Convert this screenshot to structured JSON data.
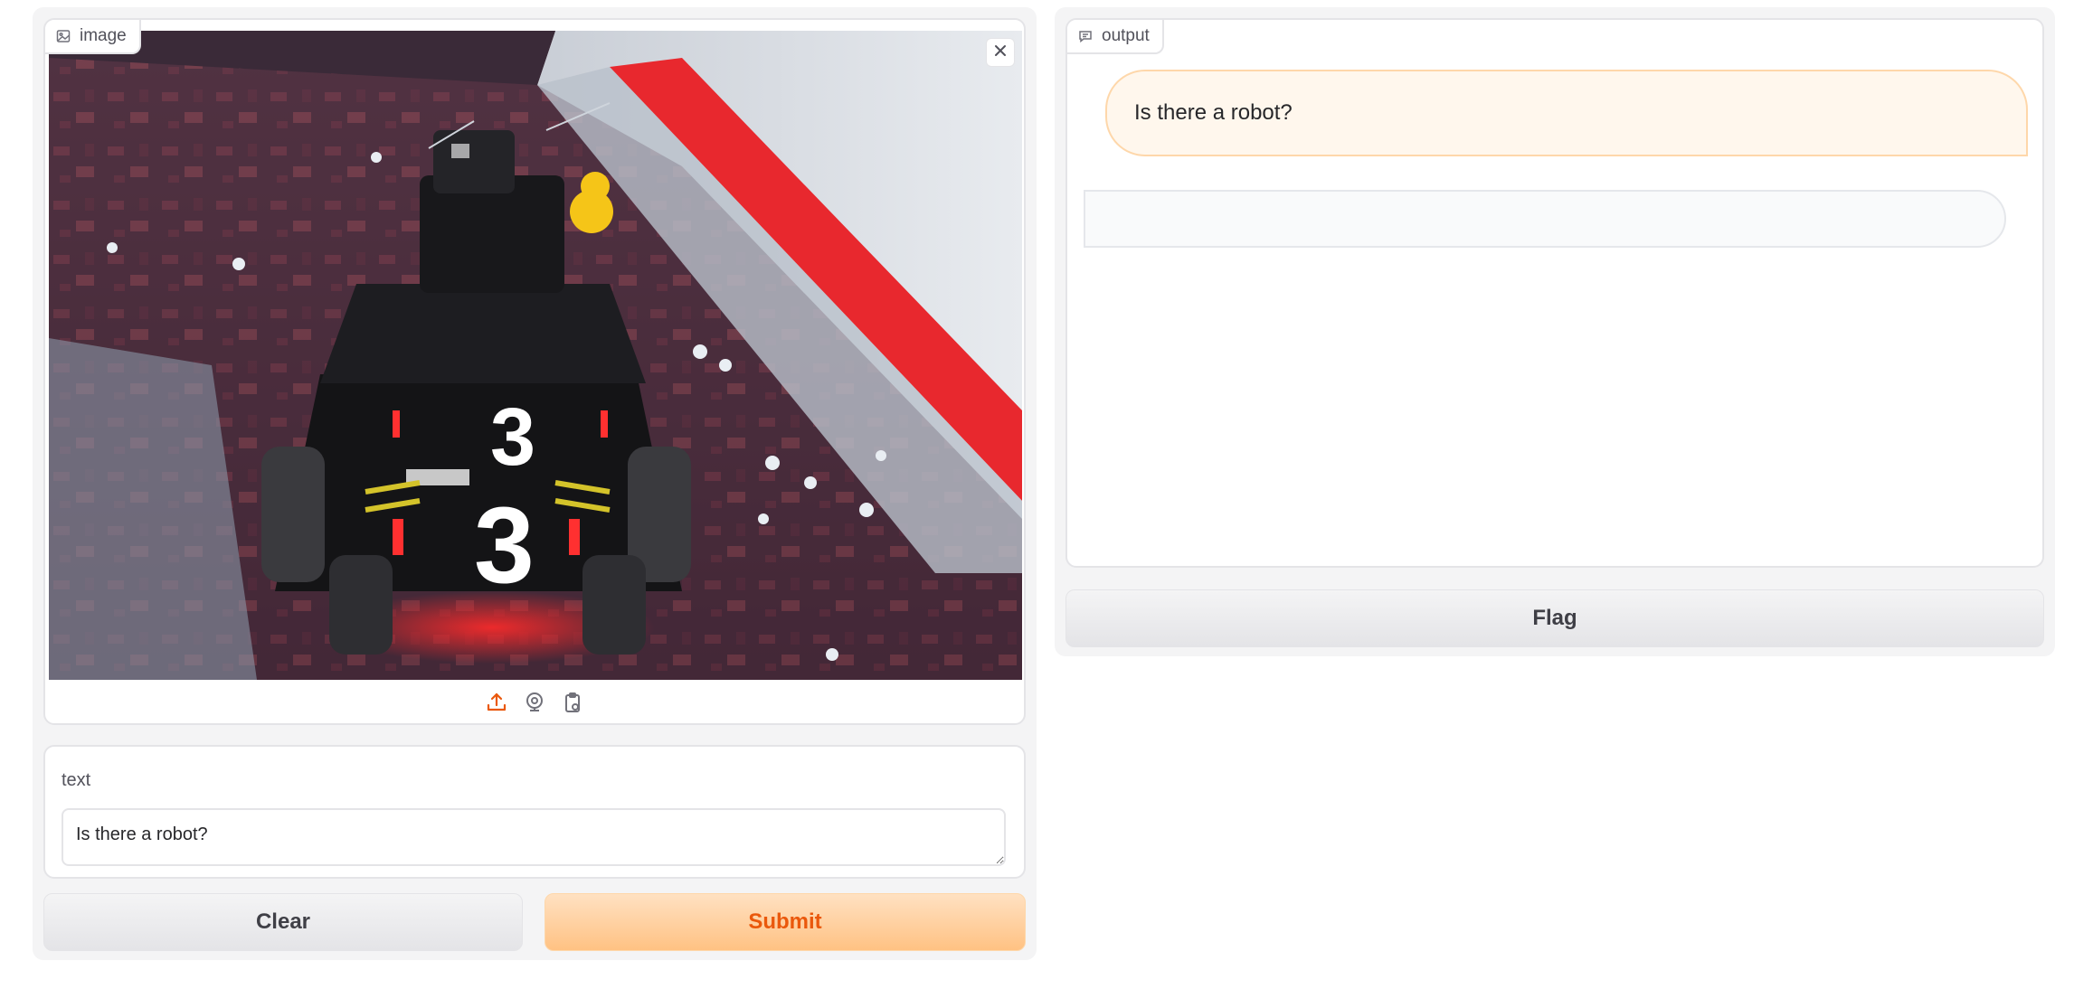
{
  "image_input": {
    "label": "image",
    "icon": "image-icon",
    "remove_icon": "close-icon",
    "source_icons": [
      "upload-icon",
      "webcam-icon",
      "clipboard-icon"
    ],
    "accent_color": "#ea580c"
  },
  "text_input": {
    "label": "text",
    "value": "Is there a robot?"
  },
  "buttons": {
    "clear": "Clear",
    "submit": "Submit",
    "flag": "Flag"
  },
  "output": {
    "label": "output",
    "icon": "chat-icon",
    "messages": [
      {
        "role": "user",
        "text": "Is there a robot?"
      },
      {
        "role": "bot",
        "text": ""
      }
    ]
  }
}
